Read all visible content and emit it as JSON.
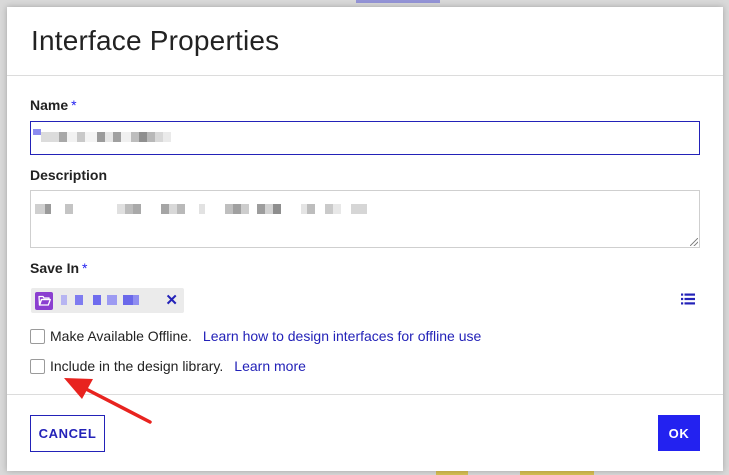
{
  "dialog": {
    "title": "Interface Properties"
  },
  "name_field": {
    "label": "Name",
    "required_mark": "*"
  },
  "description_field": {
    "label": "Description"
  },
  "save_in_field": {
    "label": "Save In",
    "required_mark": "*",
    "folder_icon": "folder-open-icon",
    "remove_icon": "close-icon",
    "remove_glyph": "✕",
    "picker_icon": "list-icon"
  },
  "offline_option": {
    "label": "Make Available Offline.",
    "checked": false,
    "link": "Learn how to design interfaces for offline use"
  },
  "design_library_option": {
    "label": "Include in the design library.",
    "checked": false,
    "link": "Learn more"
  },
  "footer": {
    "cancel_label": "CANCEL",
    "ok_label": "OK"
  },
  "colors": {
    "accent": "#2322f0",
    "accent_dark": "#2322b8",
    "folder_icon": "#8b3fd0",
    "annotation_arrow": "#e8231f"
  }
}
